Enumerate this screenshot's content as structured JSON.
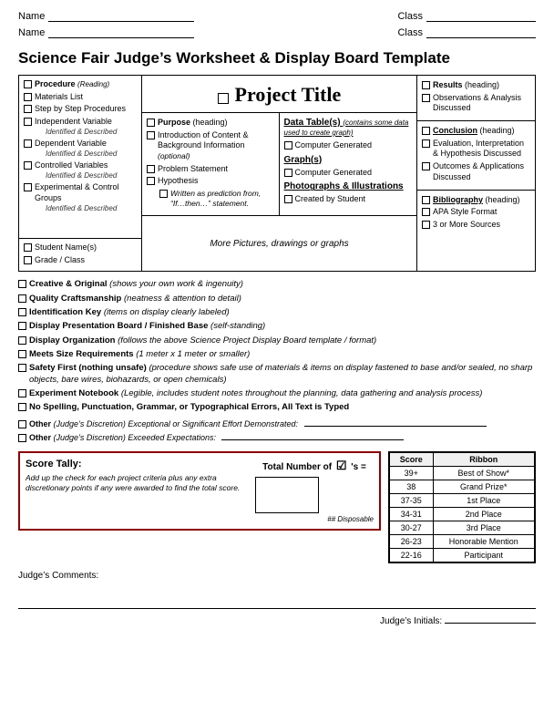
{
  "header": {
    "name_label": "Name",
    "class_label": "Class",
    "name_label2": "Name",
    "class_label2": "Class"
  },
  "title": "Science Fair Judge’s Worksheet & Display Board Template",
  "project_title": "Project Title",
  "procedures": {
    "heading": "Procedure",
    "reading": "(Reading)",
    "items": [
      {
        "label": "Materials List"
      },
      {
        "label": "Step by Step Procedures"
      },
      {
        "label": "Independent Variable",
        "sub": "Identified & Described"
      },
      {
        "label": "Dependent Variable",
        "sub": "Identified & Described"
      },
      {
        "label": "Controlled Variables",
        "sub": "Identified & Described"
      },
      {
        "label": "Experimental & Control Groups",
        "sub": "Identified & Described"
      }
    ]
  },
  "student_section": {
    "items": [
      {
        "label": "Student Name(s)"
      },
      {
        "label": "Grade / Class"
      }
    ]
  },
  "purpose": {
    "heading": "Purpose",
    "reading": "(heading)",
    "items": [
      {
        "label": "Introduction of Content & Background Information",
        "sub": "(optional)"
      },
      {
        "label": "Problem Statement"
      },
      {
        "label": "Hypothesis"
      }
    ],
    "hypothesis_note": "Written as prediction from, “If…then…” statement."
  },
  "data": {
    "heading": "Data Table(s)",
    "heading_note": "(contains some data used to create graph)",
    "items": [
      {
        "label": "Computer Generated"
      }
    ],
    "graphs_heading": "Graph(s)",
    "graphs_items": [
      {
        "label": "Computer Generated"
      }
    ],
    "photos_heading": "Photographs & Illustrations",
    "photos_items": [
      {
        "label": "Created by Student"
      }
    ]
  },
  "results": {
    "heading": "Results",
    "reading": "(heading)",
    "items": [
      {
        "label": "Observations & Analysis Discussed"
      }
    ]
  },
  "conclusion": {
    "heading": "Conclusion",
    "reading": "(heading)",
    "items": [
      {
        "label": "Evaluation, Interpretation & Hypothesis Discussed"
      },
      {
        "label": "Outcomes & Applications Discussed"
      }
    ]
  },
  "bibliography": {
    "heading": "Bibliography",
    "reading": "(heading)",
    "items": [
      {
        "label": "APA Style Format"
      },
      {
        "label": "3 or More Sources"
      }
    ]
  },
  "more_pics": "More Pictures, drawings or graphs",
  "checklist": {
    "items": [
      {
        "label": "Creative & Original",
        "note": "(shows your own work & ingenuity)"
      },
      {
        "label": "Quality Craftsmanship",
        "note": "(neatness & attention to detail)"
      },
      {
        "label": "Identification Key",
        "note": "(items on display clearly labeled)"
      },
      {
        "label": "Display Presentation Board / Finished Base",
        "note": "(self-standing)"
      },
      {
        "label": "Display Organization",
        "note": "(follows the above Science Project Display Board template / format)"
      },
      {
        "label": "Meets Size Requirements",
        "note": "(1 meter x 1 meter or smaller)"
      },
      {
        "label": "Safety First (nothing unsafe)",
        "note": "(procedure shows safe use of materials & items on display fastened to base and/or sealed, no sharp objects, bare wires, biohazards, or open chemicals)"
      },
      {
        "label": "Experiment Notebook",
        "note": "(Legible, includes student notes throughout the planning, data gathering and analysis process)"
      },
      {
        "label": "No Spelling, Punctuation, Grammar, or Typographical Errors, All Text is Typed"
      }
    ]
  },
  "other1": {
    "label": "Other",
    "note": "(Judge’s Discretion) Exceptional or Significant Effort Demonstrated:"
  },
  "other2": {
    "label": "Other",
    "note": "(Judge’s Discretion) Exceeded Expectations:"
  },
  "score_tally": {
    "title": "Score Tally:",
    "description": "Add up the check for each project criteria plus any extra discretionary points if any were awarded to find the total score.",
    "total_label": "Total Number of",
    "checkmark": "☑",
    "apostrophe": "'s =",
    "disposable": "## Disposable"
  },
  "score_table": {
    "headers": [
      "Score",
      "Ribbon"
    ],
    "rows": [
      {
        "score": "39+",
        "ribbon": "Best of Show*"
      },
      {
        "score": "38",
        "ribbon": "Grand Prize*"
      },
      {
        "score": "37-35",
        "ribbon": "1st Place"
      },
      {
        "score": "34-31",
        "ribbon": "2nd Place"
      },
      {
        "score": "30-27",
        "ribbon": "3rd Place"
      },
      {
        "score": "26-23",
        "ribbon": "Honorable Mention"
      },
      {
        "score": "22-16",
        "ribbon": "Participant"
      }
    ]
  },
  "judges_comments": {
    "label": "Judge’s Comments:"
  },
  "judges_initials": {
    "label": "Judge’s Initials:"
  }
}
